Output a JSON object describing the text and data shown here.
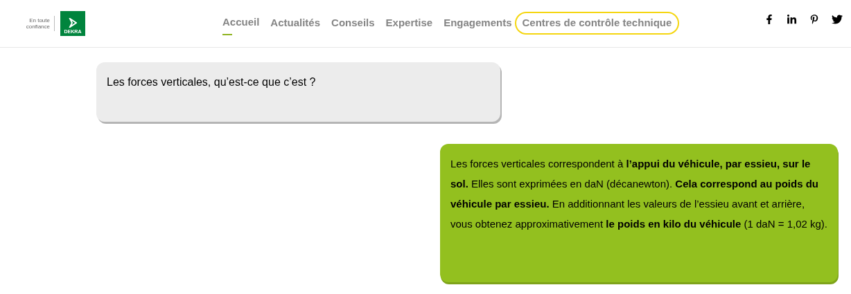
{
  "header": {
    "tagline": "En toute confiance",
    "logo_text": "DEKRA",
    "nav": [
      {
        "label": "Accueil",
        "selected": true,
        "highlighted": false
      },
      {
        "label": "Actualités",
        "selected": false,
        "highlighted": false
      },
      {
        "label": "Conseils",
        "selected": false,
        "highlighted": false
      },
      {
        "label": "Expertise",
        "selected": false,
        "highlighted": false
      },
      {
        "label": "Engagements",
        "selected": false,
        "highlighted": false
      },
      {
        "label": "Centres de contrôle technique",
        "selected": false,
        "highlighted": true
      }
    ]
  },
  "messages": [
    {
      "kind": "question",
      "text": "Les forces verticales, qu’est-ce que c’est ?"
    },
    {
      "kind": "answer",
      "text": "Les forces verticales correspondent à **l’appui du véhicule, par essieu, sur le sol.** Elles sont exprimées en daN (décanewton). **Cela correspond au poids du véhicule par essieu.** En additionnant les valeurs de l’essieu avant et arrière, vous obtenez approximativement **le poids en kilo du véhicule** (1 daN = 1,02 kg)."
    }
  ]
}
